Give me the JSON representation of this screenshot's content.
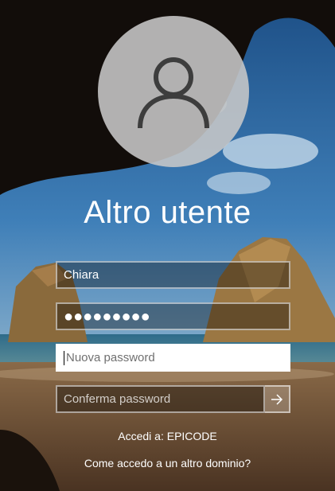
{
  "user": {
    "display_name": "Altro utente"
  },
  "form": {
    "username_value": "Chiara",
    "password_value": "●●●●●●●●●",
    "new_password_placeholder": "Nuova password",
    "confirm_password_placeholder": "Conferma password",
    "submit_icon": "arrow-right-icon"
  },
  "footer": {
    "sign_in_to": "Accedi a: EPICODE",
    "other_domain_link": "Come accedo a un altro dominio?"
  },
  "icons": {
    "avatar": "user-icon"
  },
  "colors": {
    "avatar_bg": "#c8c8c8",
    "field_border": "#ffffff",
    "active_field_bg": "#ffffff"
  }
}
